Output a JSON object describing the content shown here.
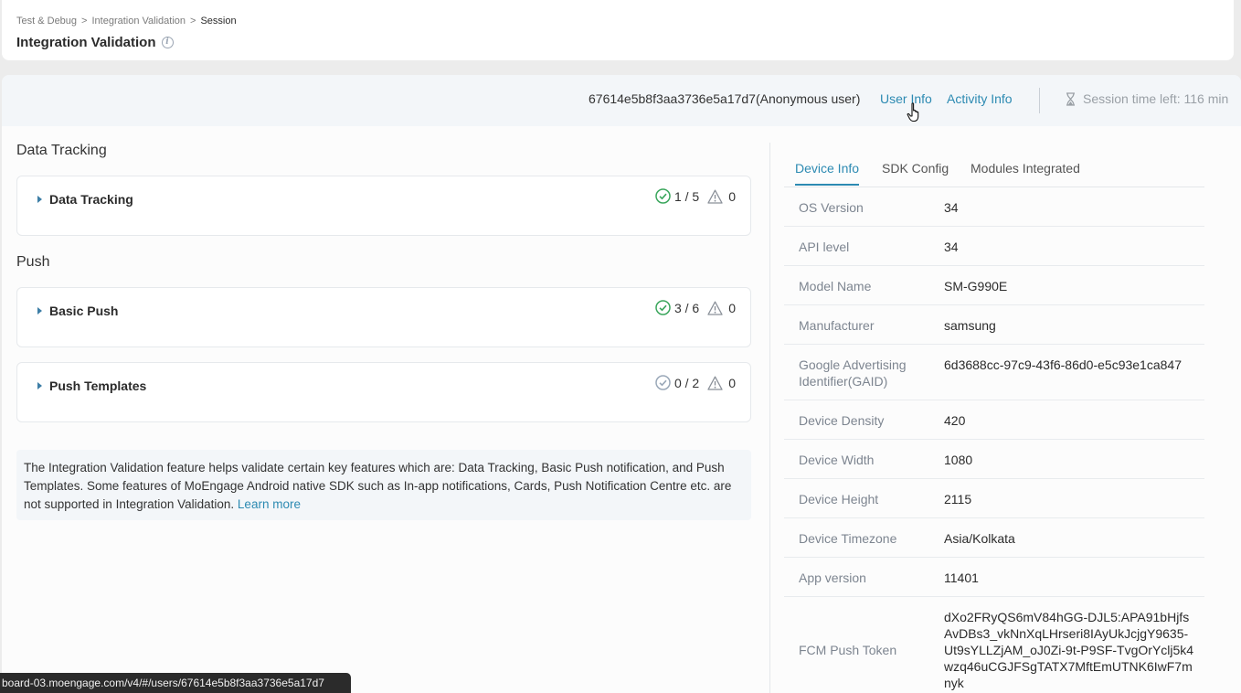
{
  "breadcrumb": {
    "items": [
      "Test & Debug",
      "Integration Validation",
      "Session"
    ],
    "sep": ">"
  },
  "page": {
    "title": "Integration Validation"
  },
  "session": {
    "id_text": "67614e5b8f3aa3736e5a17d7(Anonymous user)",
    "user_info": "User Info",
    "activity_info": "Activity Info",
    "time_left": "Session time left: 116 min"
  },
  "sections": {
    "data_tracking": "Data Tracking",
    "push": "Push"
  },
  "cards": [
    {
      "label": "Data Tracking",
      "passed": "1 / 5",
      "warnings": "0"
    },
    {
      "label": "Basic Push",
      "passed": "3 / 6",
      "warnings": "0"
    },
    {
      "label": "Push Templates",
      "passed": "0 / 2",
      "warnings": "0"
    }
  ],
  "note": {
    "text": "The Integration Validation feature helps validate certain key features which are: Data Tracking, Basic Push notification, and Push Templates. Some features of MoEngage Android native SDK such as In-app notifications, Cards, Push Notification Centre etc. are not supported in Integration Validation. ",
    "link": "Learn more"
  },
  "tabs": [
    "Device Info",
    "SDK Config",
    "Modules Integrated"
  ],
  "device_info": [
    {
      "key": "OS Version",
      "value": "34"
    },
    {
      "key": "API level",
      "value": "34"
    },
    {
      "key": "Model Name",
      "value": "SM-G990E"
    },
    {
      "key": "Manufacturer",
      "value": "samsung"
    },
    {
      "key": "Google Advertising Identifier(GAID)",
      "value": "6d3688cc-97c9-43f6-86d0-e5c93e1ca847"
    },
    {
      "key": "Device Density",
      "value": "420"
    },
    {
      "key": "Device Width",
      "value": "1080"
    },
    {
      "key": "Device Height",
      "value": "2115"
    },
    {
      "key": "Device Timezone",
      "value": "Asia/Kolkata"
    },
    {
      "key": "App version",
      "value": "11401"
    },
    {
      "key": "FCM Push Token",
      "value": "dXo2FRyQS6mV84hGG-DJL5:APA91bHjfsAvDBs3_vkNnXqLHrseri8IAyUkJcjgY9635-Ut9sYLLZjAM_oJ0Zi-9t-P9SF-TvgOrYclj5k4wzq46uCGJFSgTATX7MftEmUTNK6IwF7mnyk"
    }
  ],
  "status_bar": {
    "url": "board-03.moengage.com/v4/#/users/67614e5b8f3aa3736e5a17d7"
  },
  "colors": {
    "accent": "#2c8ab2",
    "success": "#3aa65c",
    "warning": "#8a9099"
  }
}
